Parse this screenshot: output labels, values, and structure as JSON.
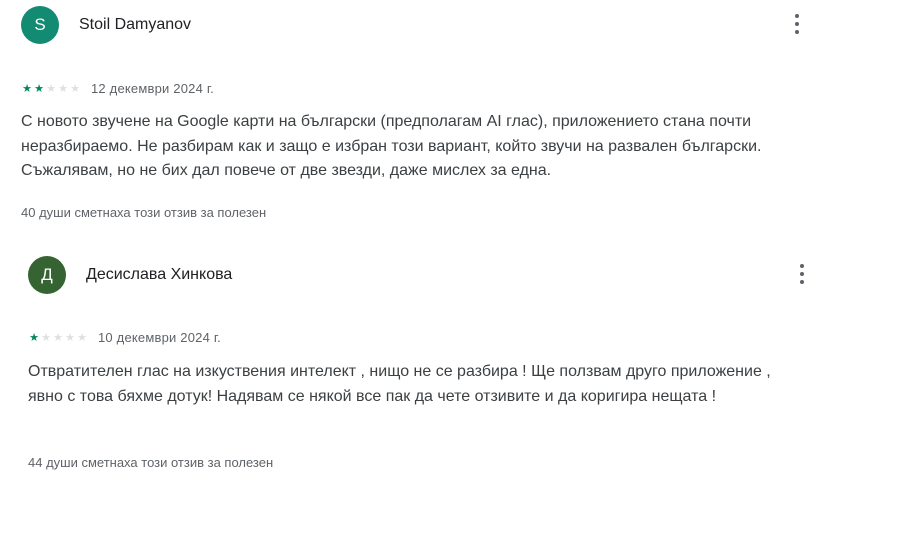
{
  "reviews": [
    {
      "author": "Stoil Damyanov",
      "avatar_letter": "S",
      "avatar_color": "#138a72",
      "rating": 2,
      "rating_max": 5,
      "date": "12 декември 2024 г.",
      "text": "С новото звучене на Google карти на български (предполагам AI глас), приложението стана почти неразбираемо. Не разбирам как и защо е избран този вариант, който звучи на развален български. Съжалявам, но не бих дал повече от две звезди, даже мислех за една.",
      "helpful": "40 души сметнаха този отзив за полезен",
      "menu_icon": "more-vert-icon"
    },
    {
      "author": "Десислава Хинкова",
      "avatar_letter": "Д",
      "avatar_color": "#356332",
      "rating": 1,
      "rating_max": 5,
      "date": "10 декември 2024 г.",
      "text": "Отвратителен глас на изкуствения интелект , нищо не се разбира ! Ще ползвам друго приложение , явно с това бяхме дотук! Надявам се някой все пак да чете отзивите и да коригира нещата !",
      "helpful": "44 души сметнаха този отзив за полезен",
      "menu_icon": "more-vert-icon"
    }
  ],
  "colors": {
    "star_filled": "#01875f",
    "star_empty": "#e0e0e0",
    "secondary_text": "#5f6368"
  }
}
